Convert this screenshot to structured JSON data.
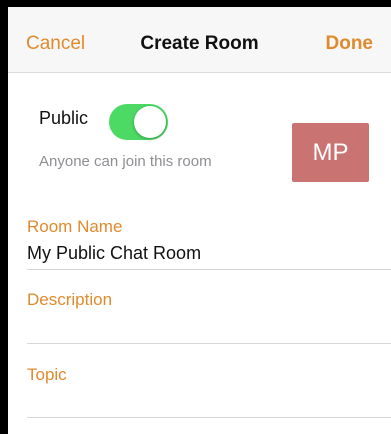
{
  "navbar": {
    "cancel_label": "Cancel",
    "title": "Create Room",
    "done_label": "Done"
  },
  "visibility": {
    "label": "Public",
    "toggle_on": true,
    "hint": "Anyone can join this room"
  },
  "avatar": {
    "initials": "MP",
    "color": "#c97372"
  },
  "fields": {
    "room_name": {
      "label": "Room Name",
      "value": "My Public Chat Room"
    },
    "description": {
      "label": "Description",
      "value": ""
    },
    "topic": {
      "label": "Topic",
      "value": ""
    }
  },
  "colors": {
    "accent": "#e08a2e",
    "toggle_on": "#4cd964"
  }
}
